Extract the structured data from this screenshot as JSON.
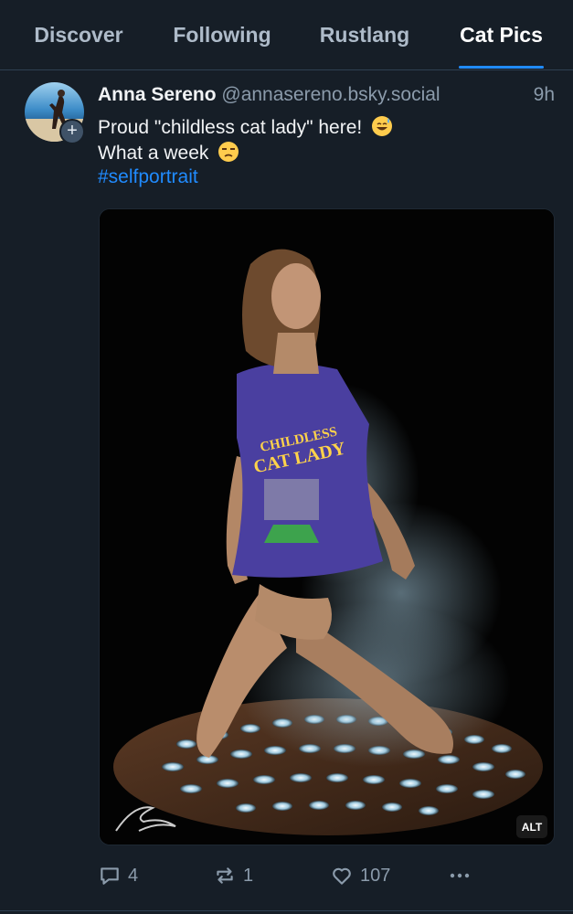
{
  "tabs": [
    {
      "label": "Discover",
      "active": false
    },
    {
      "label": "Following",
      "active": false
    },
    {
      "label": "Rustlang",
      "active": false
    },
    {
      "label": "Cat Pics",
      "active": true
    }
  ],
  "post": {
    "display_name": "Anna Sereno",
    "handle": "@annasereno.bsky.social",
    "time": "9h",
    "text_line1": "Proud \"childless cat lady\" here!",
    "text_line1_emoji": "sweat-smile-emoji",
    "text_line2": "What a week",
    "text_line2_emoji": "unamused-emoji",
    "hashtag": "#selfportrait",
    "image_alt_label": "ALT",
    "shirt_text_line1": "CHILDLESS",
    "shirt_text_line2": "CAT LADY",
    "counts": {
      "replies": "4",
      "reposts": "1",
      "likes": "107"
    }
  },
  "colors": {
    "background": "#161e27",
    "accent": "#208bfe",
    "muted": "#8b9bab"
  },
  "icons": [
    "plus-icon",
    "reply-icon",
    "repost-icon",
    "heart-icon",
    "more-icon",
    "signature-icon"
  ]
}
